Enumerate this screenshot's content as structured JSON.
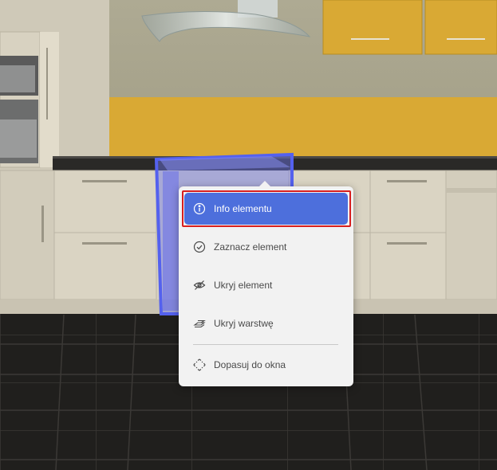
{
  "context_menu": {
    "items": [
      {
        "label": "Info elementu",
        "icon": "info-icon",
        "active": true
      },
      {
        "label": "Zaznacz element",
        "icon": "check-circle-icon",
        "active": false
      },
      {
        "label": "Ukryj element",
        "icon": "eye-off-icon",
        "active": false
      },
      {
        "label": "Ukryj warstwę",
        "icon": "layers-icon",
        "active": false
      },
      {
        "label": "Dopasuj do okna",
        "icon": "fit-window-icon",
        "active": false
      }
    ]
  },
  "colors": {
    "accent": "#4d6fdc",
    "highlight_outline": "#d81f1f",
    "selection_outline": "#5461ee",
    "cabinet_upper": "#d9a934",
    "menu_background": "#f2f2f2"
  }
}
